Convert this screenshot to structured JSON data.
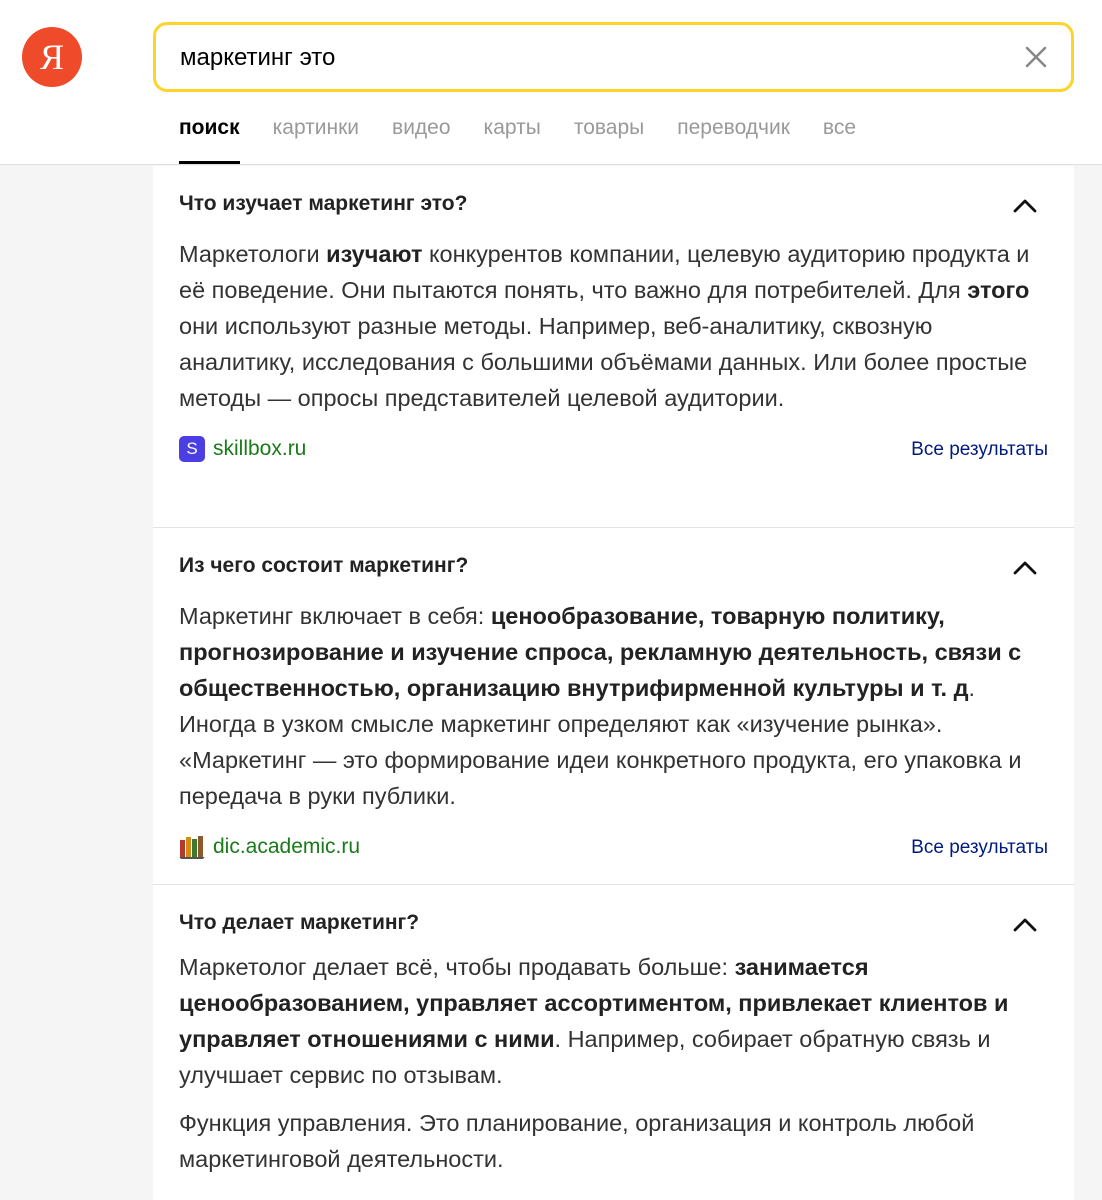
{
  "header": {
    "logo_letter": "Я",
    "search_value": "маркетинг это",
    "tabs": [
      "поиск",
      "картинки",
      "видео",
      "карты",
      "товары",
      "переводчик",
      "все"
    ]
  },
  "qa": [
    {
      "question": "Что изучает маркетинг это?",
      "answer_parts": [
        {
          "t": "Маркетологи ",
          "b": false
        },
        {
          "t": "изучают",
          "b": true
        },
        {
          "t": " конкурентов компании, целевую аудиторию продукта и её поведение. Они пытаются понять, что важно для потребителей. Для ",
          "b": false
        },
        {
          "t": "этого",
          "b": true
        },
        {
          "t": " они используют разные методы. Например, веб-аналитику, сквозную аналитику, исследования с большими объёмами данных. Или более простые методы — опросы представителей целевой аудитории.",
          "b": false
        }
      ],
      "source": "skillbox.ru",
      "favicon_letter": "S",
      "all_results": "Все результаты"
    },
    {
      "question": "Из чего состоит маркетинг?",
      "answer_parts": [
        {
          "t": "Маркетинг включает в себя: ",
          "b": false
        },
        {
          "t": "ценообразование, товарную политику, прогнозирование и изучение спроса, рекламную деятельность, связи с общественностью, организацию внутрифирменной культуры и т. д",
          "b": true
        },
        {
          "t": ". Иногда в узком смысле маркетинг определяют как «изучение рынка». «Маркетинг — это формирование идеи конкретного продукта, его упаковка и передача в руки публики.",
          "b": false
        }
      ],
      "source": "dic.academic.ru",
      "all_results": "Все результаты"
    },
    {
      "question": "Что делает маркетинг?",
      "answer_parts": [
        {
          "t": "Маркетолог делает всё, чтобы продавать больше: ",
          "b": false
        },
        {
          "t": "занимается ценообразованием, управляет ассортиментом, привлекает клиентов и управляет отношениями с ними",
          "b": true
        },
        {
          "t": ". Например, собирает обратную связь и улучшает сервис по отзывам.",
          "b": false
        }
      ],
      "extra_paragraph": "Функция управления. Это планирование, организация и контроль любой маркетинговой деятельности."
    }
  ]
}
